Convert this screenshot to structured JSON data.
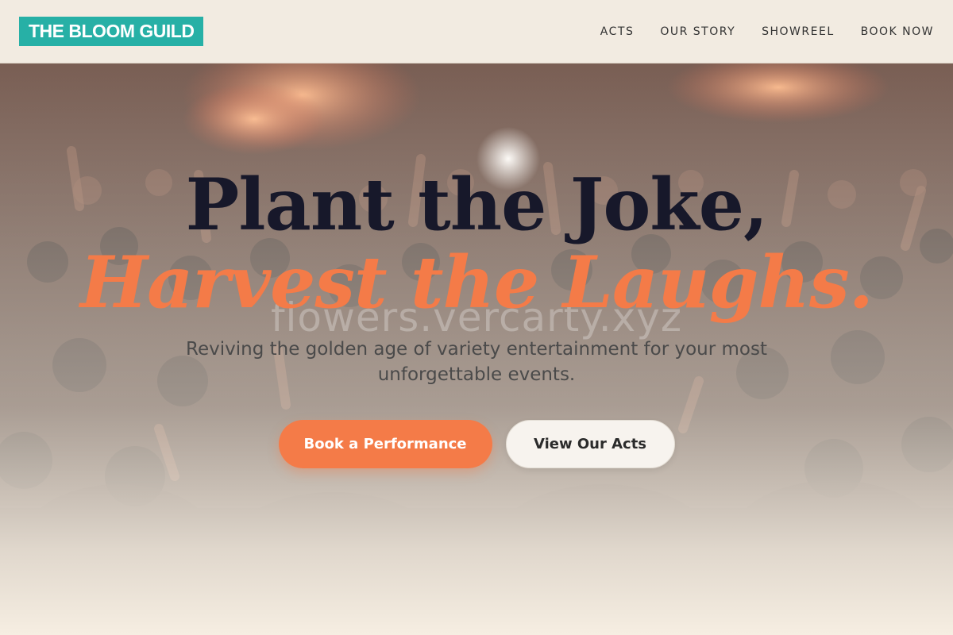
{
  "brand": {
    "logo_text": "THE BLOOM GUILD",
    "accent_color": "#27b0a6"
  },
  "nav": {
    "items": [
      {
        "label": "ACTS"
      },
      {
        "label": "OUR STORY"
      },
      {
        "label": "SHOWREEL"
      },
      {
        "label": "BOOK NOW"
      }
    ]
  },
  "hero": {
    "headline_line1": "Plant the Joke,",
    "headline_line2": "Harvest the Laughs.",
    "watermark": "flowers.vercarty.xyz",
    "subtitle": "Reviving the golden age of variety entertainment for your most unforgettable events.",
    "primary_cta": "Book a Performance",
    "secondary_cta": "View Our Acts",
    "highlight_color": "#f47b48",
    "background_image": "concert-crowd-photo"
  }
}
